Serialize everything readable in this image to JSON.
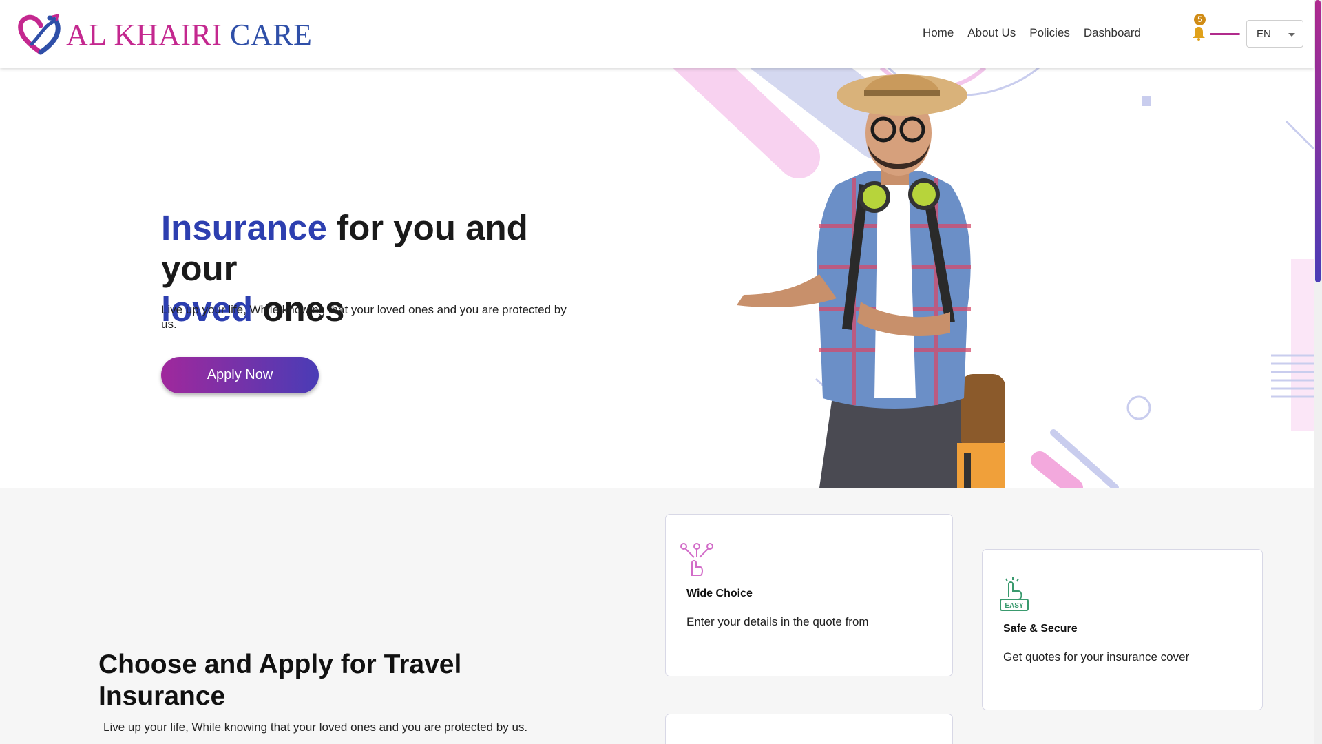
{
  "brand": {
    "name_part1": "AL KHAIRI",
    "name_part2": "CARE",
    "primary_color": "#c4288f",
    "secondary_color": "#2f4fa8"
  },
  "nav": {
    "items": [
      {
        "label": "Home"
      },
      {
        "label": "About Us"
      },
      {
        "label": "Policies"
      },
      {
        "label": "Dashboard"
      }
    ],
    "notification_count": "5",
    "language": "EN"
  },
  "hero": {
    "title_hl1": "Insurance",
    "title_rest1": " for you and your",
    "title_hl2": "loved",
    "title_rest2": " ones",
    "subtitle": "Live up your life, While knowing that your loved ones and you are protected by us.",
    "cta_label": "Apply Now",
    "accent_color": "#2d3fb0"
  },
  "features": {
    "title": "Choose and Apply for Travel Insurance",
    "subtitle": "Live up your life, While knowing that your loved ones and you are protected by us.",
    "cards": [
      {
        "icon": "wide-choice-icon",
        "title": "Wide Choice",
        "text": "Enter your details in the quote from"
      },
      {
        "icon": "easy-tap-icon",
        "title": "Safe & Secure",
        "text": "Get quotes for your insurance cover"
      }
    ]
  }
}
